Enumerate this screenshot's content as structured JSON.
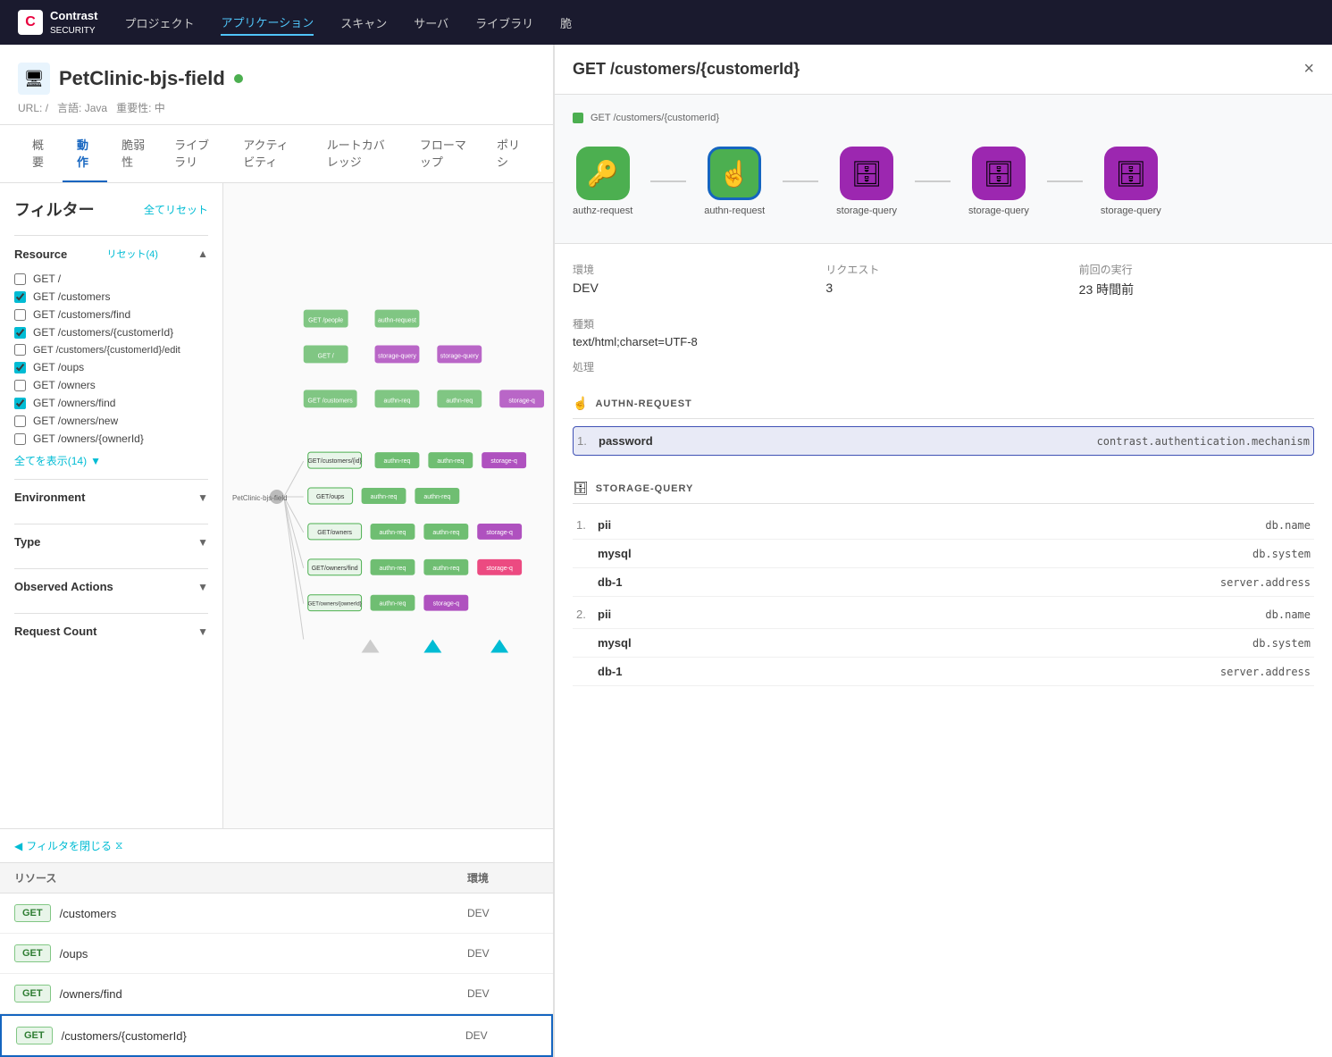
{
  "nav": {
    "logo_text": "Contrast Security",
    "items": [
      "プロジェクト",
      "アプリケーション",
      "スキャン",
      "サーバ",
      "ライブラリ",
      "脆"
    ],
    "active_item": "アプリケーション"
  },
  "app": {
    "name": "PetClinic-bjs-field",
    "icon": "🖥",
    "status": "active",
    "url_label": "URL:",
    "url": "/",
    "lang_label": "言語: Java",
    "severity_label": "重要性: 中"
  },
  "tabs": [
    {
      "label": "概要",
      "active": false
    },
    {
      "label": "動作",
      "active": true
    },
    {
      "label": "脆弱性",
      "active": false
    },
    {
      "label": "ライブラリ",
      "active": false
    },
    {
      "label": "アクティビティ",
      "active": false
    },
    {
      "label": "ルートカバレッジ",
      "active": false
    },
    {
      "label": "フローマップ",
      "active": false
    },
    {
      "label": "ポリシ",
      "active": false
    }
  ],
  "filter": {
    "title": "フィルター",
    "reset_all": "全てリセット",
    "sections": [
      {
        "label": "Resource",
        "action": "リセット(4)",
        "items": [
          {
            "label": "GET /",
            "checked": false
          },
          {
            "label": "GET /customers",
            "checked": true
          },
          {
            "label": "GET /customers/find",
            "checked": false
          },
          {
            "label": "GET /customers/{customerId}",
            "checked": true
          },
          {
            "label": "GET /customers/{customerId}/edit",
            "checked": false
          },
          {
            "label": "GET /oups",
            "checked": true
          },
          {
            "label": "GET /owners",
            "checked": false
          },
          {
            "label": "GET /owners/find",
            "checked": true
          },
          {
            "label": "GET /owners/new",
            "checked": false
          },
          {
            "label": "GET /owners/{ownerId}",
            "checked": false
          }
        ],
        "show_more": "全てを表示(14)"
      },
      {
        "label": "Environment",
        "action": "",
        "items": []
      },
      {
        "label": "Type",
        "action": "",
        "items": []
      },
      {
        "label": "Observed Actions",
        "action": "",
        "items": []
      },
      {
        "label": "Request Count",
        "action": "",
        "items": []
      }
    ],
    "close_filter": "フィルタを閉じる"
  },
  "table": {
    "columns": [
      "リソース",
      "環境"
    ],
    "rows": [
      {
        "method": "GET",
        "path": "/customers",
        "env": "DEV",
        "selected": false
      },
      {
        "method": "GET",
        "path": "/oups",
        "env": "DEV",
        "selected": false
      },
      {
        "method": "GET",
        "path": "/owners/find",
        "env": "DEV",
        "selected": false
      },
      {
        "method": "GET",
        "path": "/customers/{customerId}",
        "env": "DEV",
        "selected": true
      }
    ]
  },
  "panel": {
    "title": "GET /customers/{customerId}",
    "close": "×",
    "breadcrumb": "GET /customers/{customerId}",
    "flow_nodes": [
      {
        "label": "authz-request",
        "icon": "🔑",
        "color": "green",
        "selected": false
      },
      {
        "label": "authn-request",
        "icon": "👆",
        "color": "green",
        "selected": true
      },
      {
        "label": "storage-query",
        "icon": "🗄",
        "color": "purple",
        "selected": false
      },
      {
        "label": "storage-query",
        "icon": "🗄",
        "color": "purple",
        "selected": false
      },
      {
        "label": "storage-query",
        "icon": "🗄",
        "color": "purple",
        "selected": false
      }
    ],
    "meta": {
      "env_label": "環境",
      "env_value": "DEV",
      "req_label": "リクエスト",
      "req_value": "3",
      "last_label": "前回の実行",
      "last_value": "23 時間前"
    },
    "type_label": "種類",
    "type_value": "text/html;charset=UTF-8",
    "process_label": "処理",
    "sections": [
      {
        "tag": "AUTHN-REQUEST",
        "icon": "👆",
        "rows": [
          {
            "num": "1.",
            "key": "password",
            "value": "contrast.authentication.mechanism",
            "highlighted": true
          }
        ]
      },
      {
        "tag": "STORAGE-QUERY",
        "icon": "🗄",
        "rows": [
          {
            "num": "1.",
            "key": "pii",
            "value": "db.name",
            "highlighted": false
          },
          {
            "num": "",
            "key": "mysql",
            "value": "db.system",
            "highlighted": false
          },
          {
            "num": "",
            "key": "db-1",
            "value": "server.address",
            "highlighted": false
          },
          {
            "num": "2.",
            "key": "pii",
            "value": "db.name",
            "highlighted": false
          },
          {
            "num": "",
            "key": "mysql",
            "value": "db.system",
            "highlighted": false
          },
          {
            "num": "",
            "key": "db-1",
            "value": "server.address",
            "highlighted": false
          }
        ]
      }
    ]
  }
}
